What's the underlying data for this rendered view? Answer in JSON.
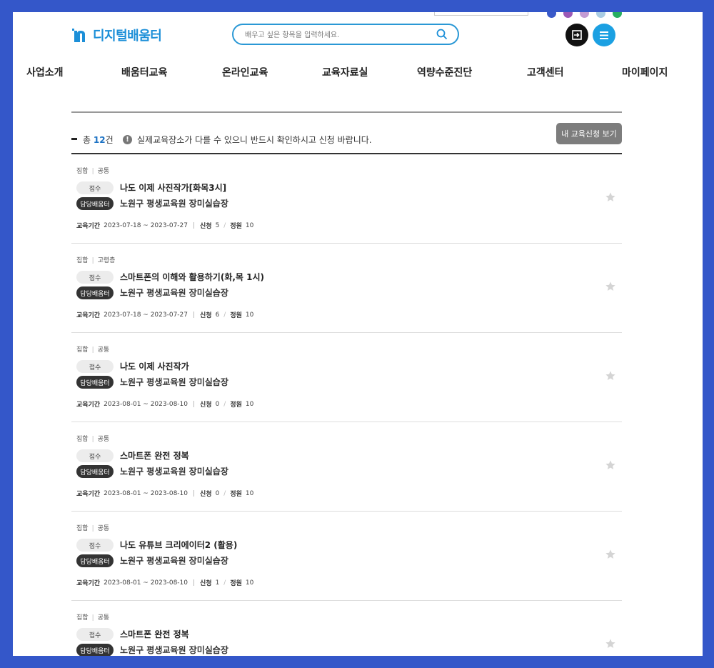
{
  "header": {
    "logo_text": "디지털배움터",
    "search_placeholder": "배우고 싶은 항목을 입력하세요.",
    "dot_colors": [
      "#3a5ac9",
      "#9b59b6",
      "#c39bd3",
      "#a9cce3",
      "#27ae60"
    ]
  },
  "nav": [
    "사업소개",
    "배움터교육",
    "온라인교육",
    "교육자료실",
    "역량수준진단",
    "고객센터",
    "마이페이지"
  ],
  "summary": {
    "total_prefix": "총",
    "total_count": "12",
    "total_suffix": "건",
    "notice": "실제교육장소가 다를 수 있으니 반드시 확인하시고 신청 바랍니다.",
    "my_button": "내 교육신청 보기"
  },
  "labels": {
    "period": "교육기간",
    "applied": "신청",
    "capacity": "정원"
  },
  "courses": [
    {
      "type": "집합",
      "audience": "공통",
      "status": "접수",
      "title": "나도 이제 사진작가[화목3시]",
      "org": "담당배움터",
      "place": "노원구 평생교육원 장미실습장",
      "period": "2023-07-18 ~ 2023-07-27",
      "applied": "5",
      "capacity": "10"
    },
    {
      "type": "집합",
      "audience": "고령층",
      "status": "접수",
      "title": "스마트폰의 이해와 활용하기(화,목 1시)",
      "org": "담당배움터",
      "place": "노원구 평생교육원 장미실습장",
      "period": "2023-07-18 ~ 2023-07-27",
      "applied": "6",
      "capacity": "10"
    },
    {
      "type": "집합",
      "audience": "공통",
      "status": "접수",
      "title": "나도 이제 사진작가",
      "org": "담당배움터",
      "place": "노원구 평생교육원 장미실습장",
      "period": "2023-08-01 ~ 2023-08-10",
      "applied": "0",
      "capacity": "10"
    },
    {
      "type": "집합",
      "audience": "공통",
      "status": "접수",
      "title": "스마트폰 완전 정복",
      "org": "담당배움터",
      "place": "노원구 평생교육원 장미실습장",
      "period": "2023-08-01 ~ 2023-08-10",
      "applied": "0",
      "capacity": "10"
    },
    {
      "type": "집합",
      "audience": "공통",
      "status": "접수",
      "title": "나도 유튜브 크리에이터2 (활용)",
      "org": "담당배움터",
      "place": "노원구 평생교육원 장미실습장",
      "period": "2023-08-01 ~ 2023-08-10",
      "applied": "1",
      "capacity": "10"
    },
    {
      "type": "집합",
      "audience": "공통",
      "status": "접수",
      "title": "스마트폰 완전 정복",
      "org": "담당배움터",
      "place": "노원구 평생교육원 장미실습장",
      "period": "",
      "applied": "",
      "capacity": ""
    }
  ]
}
